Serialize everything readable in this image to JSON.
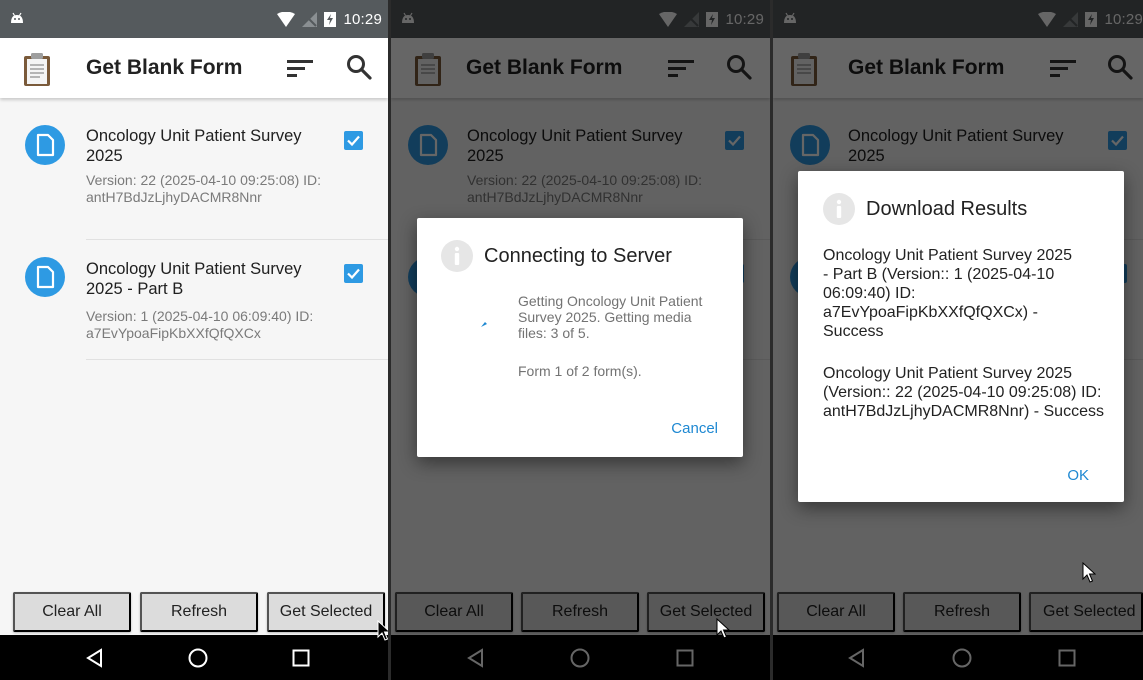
{
  "statusbar": {
    "time": "10:29"
  },
  "appbar": {
    "title": "Get Blank Form"
  },
  "forms": [
    {
      "title": "Oncology Unit Patient Survey 2025",
      "meta": "Version: 22 (2025-04-10 09:25:08) ID: antH7BdJzLjhyDACMR8Nnr",
      "checked": true
    },
    {
      "title": "Oncology Unit Patient Survey 2025 - Part B",
      "meta": "Version: 1 (2025-04-10 06:09:40) ID: a7EvYpoaFipKbXXfQfQXCx",
      "checked": true
    }
  ],
  "buttons": {
    "clear_all": "Clear All",
    "refresh": "Refresh",
    "get_selected": "Get Selected"
  },
  "connecting_dialog": {
    "title": "Connecting to Server",
    "message": "Getting Oncology Unit Patient Survey 2025. Getting media files: 3 of 5.",
    "progress": "Form 1 of 2 form(s).",
    "cancel": "Cancel"
  },
  "results_dialog": {
    "title": "Download Results",
    "result_1": "Oncology Unit Patient Survey 2025 - Part B (Version:: 1 (2025-04-10 06:09:40) ID: a7EvYpoaFipKbXXfQfQXCx) - Success",
    "result_2": "Oncology Unit Patient Survey 2025 (Version:: 22 (2025-04-10 09:25:08) ID: antH7BdJzLjhyDACMR8Nnr) - Success",
    "ok": "OK"
  },
  "colors": {
    "accent": "#2e9ae3",
    "status_bar": "#555a5d",
    "button_bg": "#dcdcdc",
    "dialog_action": "#1e88d2"
  },
  "icons": {
    "app": "clipboard-icon",
    "sort": "sort-icon",
    "search": "search-icon",
    "form": "document-icon",
    "dialog": "info-icon",
    "nav": [
      "back-icon",
      "home-icon",
      "recents-icon"
    ]
  }
}
